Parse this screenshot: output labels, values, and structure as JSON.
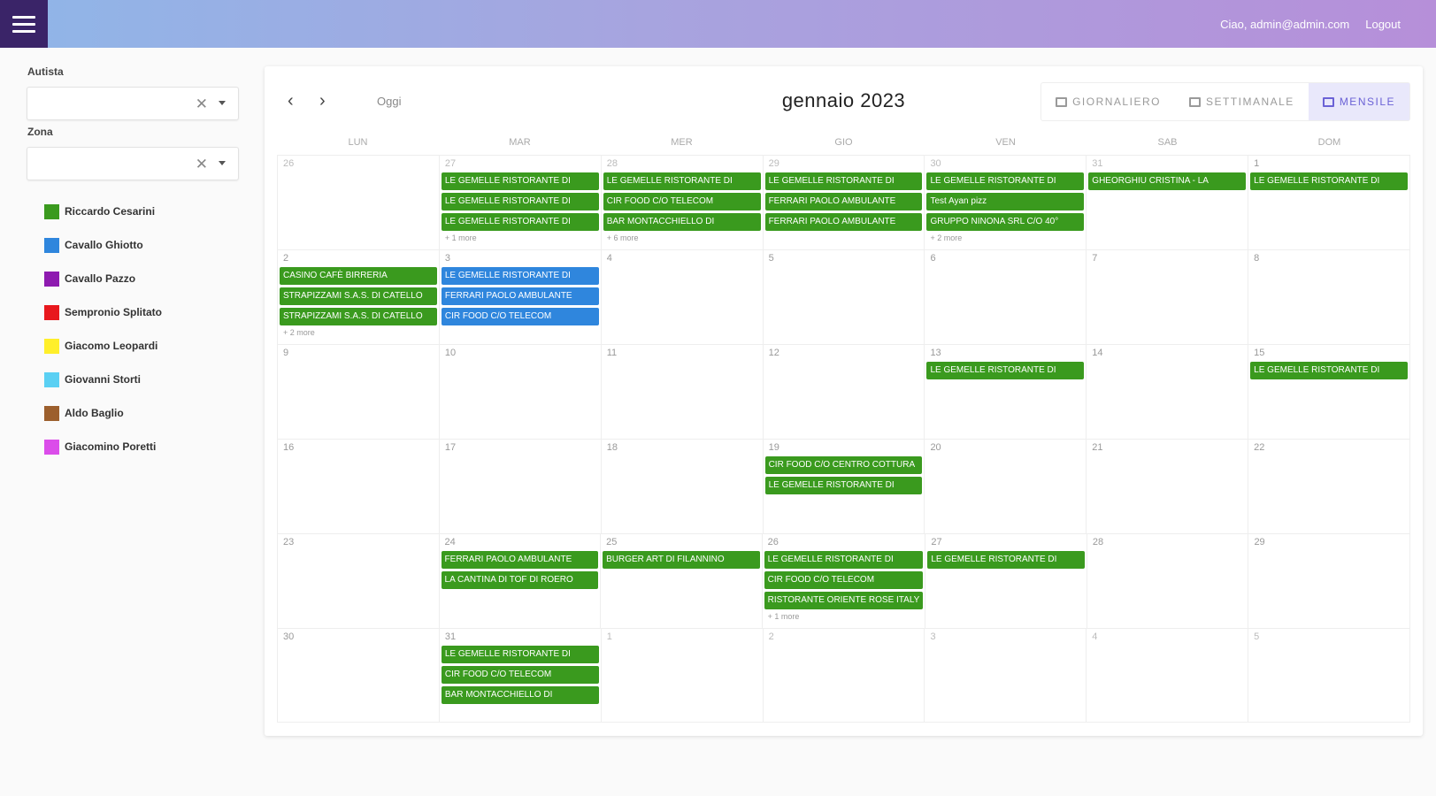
{
  "header": {
    "greeting": "Ciao, admin@admin.com",
    "logout": "Logout"
  },
  "sidebar": {
    "agent_label": "Autista",
    "zone_label": "Zona",
    "legend": [
      {
        "name": "Riccardo Cesarini",
        "color": "#3a9a1e"
      },
      {
        "name": "Cavallo Ghiotto",
        "color": "#2f86dd"
      },
      {
        "name": "Cavallo Pazzo",
        "color": "#8e1ab0"
      },
      {
        "name": "Sempronio Splitato",
        "color": "#e8181d"
      },
      {
        "name": "Giacomo Leopardi",
        "color": "#ffef2a"
      },
      {
        "name": "Giovanni Storti",
        "color": "#5ad0f3"
      },
      {
        "name": "Aldo Baglio",
        "color": "#9c5f2d"
      },
      {
        "name": "Giacomino Poretti",
        "color": "#db4dea"
      }
    ]
  },
  "calendar": {
    "title": "gennaio 2023",
    "today": "Oggi",
    "views": {
      "day": "GIORNALIERO",
      "week": "SETTIMANALE",
      "month": "MENSILE"
    },
    "weekdays": [
      "LUN",
      "MAR",
      "MER",
      "GIO",
      "VEN",
      "SAB",
      "DOM"
    ],
    "weeks": [
      [
        {
          "num": "26",
          "other": true,
          "events": []
        },
        {
          "num": "27",
          "other": true,
          "events": [
            {
              "title": "LE GEMELLE RISTORANTE DI",
              "color": "#3a9a1e"
            },
            {
              "title": "LE GEMELLE RISTORANTE DI",
              "color": "#3a9a1e"
            },
            {
              "title": "LE GEMELLE RISTORANTE DI",
              "color": "#3a9a1e"
            }
          ],
          "more": "+ 1 more"
        },
        {
          "num": "28",
          "other": true,
          "events": [
            {
              "title": "LE GEMELLE RISTORANTE DI",
              "color": "#3a9a1e"
            },
            {
              "title": "CIR FOOD C/O TELECOM",
              "color": "#3a9a1e"
            },
            {
              "title": "BAR MONTACCHIELLO DI",
              "color": "#3a9a1e"
            }
          ],
          "more": "+ 6 more"
        },
        {
          "num": "29",
          "other": true,
          "events": [
            {
              "title": "LE GEMELLE RISTORANTE DI",
              "color": "#3a9a1e"
            },
            {
              "title": "FERRARI PAOLO AMBULANTE",
              "color": "#3a9a1e"
            },
            {
              "title": "FERRARI PAOLO AMBULANTE",
              "color": "#3a9a1e"
            }
          ]
        },
        {
          "num": "30",
          "other": true,
          "events": [
            {
              "title": "LE GEMELLE RISTORANTE DI",
              "color": "#3a9a1e"
            },
            {
              "title": "Test Ayan pizz",
              "color": "#3a9a1e"
            },
            {
              "title": "GRUPPO NINONA SRL C/O 40°",
              "color": "#3a9a1e"
            }
          ],
          "more": "+ 2 more"
        },
        {
          "num": "31",
          "other": true,
          "events": [
            {
              "title": "GHEORGHIU CRISTINA - LA",
              "color": "#3a9a1e"
            }
          ]
        },
        {
          "num": "1",
          "other": false,
          "events": [
            {
              "title": "LE GEMELLE RISTORANTE DI",
              "color": "#3a9a1e"
            }
          ]
        }
      ],
      [
        {
          "num": "2",
          "other": false,
          "events": [
            {
              "title": "CASINO CAFÈ BIRRERIA",
              "color": "#3a9a1e"
            },
            {
              "title": "STRAPIZZAMI S.A.S. DI CATELLO",
              "color": "#3a9a1e"
            },
            {
              "title": "STRAPIZZAMI S.A.S. DI CATELLO",
              "color": "#3a9a1e"
            }
          ],
          "more": "+ 2 more"
        },
        {
          "num": "3",
          "other": false,
          "events": [
            {
              "title": "LE GEMELLE RISTORANTE DI",
              "color": "#2f86dd"
            },
            {
              "title": "FERRARI PAOLO AMBULANTE",
              "color": "#2f86dd"
            },
            {
              "title": "CIR FOOD C/O TELECOM",
              "color": "#2f86dd"
            }
          ]
        },
        {
          "num": "4",
          "other": false,
          "events": []
        },
        {
          "num": "5",
          "other": false,
          "events": []
        },
        {
          "num": "6",
          "other": false,
          "events": []
        },
        {
          "num": "7",
          "other": false,
          "events": []
        },
        {
          "num": "8",
          "other": false,
          "events": []
        }
      ],
      [
        {
          "num": "9",
          "other": false,
          "events": []
        },
        {
          "num": "10",
          "other": false,
          "events": []
        },
        {
          "num": "11",
          "other": false,
          "events": []
        },
        {
          "num": "12",
          "other": false,
          "events": []
        },
        {
          "num": "13",
          "other": false,
          "events": [
            {
              "title": "LE GEMELLE RISTORANTE DI",
              "color": "#3a9a1e"
            }
          ]
        },
        {
          "num": "14",
          "other": false,
          "events": []
        },
        {
          "num": "15",
          "other": false,
          "events": [
            {
              "title": "LE GEMELLE RISTORANTE DI",
              "color": "#3a9a1e"
            }
          ]
        }
      ],
      [
        {
          "num": "16",
          "other": false,
          "events": []
        },
        {
          "num": "17",
          "other": false,
          "events": []
        },
        {
          "num": "18",
          "other": false,
          "events": []
        },
        {
          "num": "19",
          "other": false,
          "events": [
            {
              "title": "CIR FOOD C/O CENTRO COTTURA",
              "color": "#3a9a1e"
            },
            {
              "title": "LE GEMELLE RISTORANTE DI",
              "color": "#3a9a1e"
            }
          ]
        },
        {
          "num": "20",
          "other": false,
          "events": []
        },
        {
          "num": "21",
          "other": false,
          "events": []
        },
        {
          "num": "22",
          "other": false,
          "events": []
        }
      ],
      [
        {
          "num": "23",
          "other": false,
          "events": []
        },
        {
          "num": "24",
          "other": false,
          "events": [
            {
              "title": "FERRARI PAOLO AMBULANTE",
              "color": "#3a9a1e"
            },
            {
              "title": "LA CANTINA DI TOF DI ROERO",
              "color": "#3a9a1e"
            }
          ]
        },
        {
          "num": "25",
          "other": false,
          "events": [
            {
              "title": "BURGER ART DI FILANNINO",
              "color": "#3a9a1e"
            }
          ]
        },
        {
          "num": "26",
          "other": false,
          "events": [
            {
              "title": "LE GEMELLE RISTORANTE DI",
              "color": "#3a9a1e"
            },
            {
              "title": "CIR FOOD C/O TELECOM",
              "color": "#3a9a1e"
            },
            {
              "title": "RISTORANTE ORIENTE ROSE ITALY",
              "color": "#3a9a1e"
            }
          ],
          "more": "+ 1 more"
        },
        {
          "num": "27",
          "other": false,
          "events": [
            {
              "title": "LE GEMELLE RISTORANTE DI",
              "color": "#3a9a1e"
            }
          ]
        },
        {
          "num": "28",
          "other": false,
          "events": []
        },
        {
          "num": "29",
          "other": false,
          "events": []
        }
      ],
      [
        {
          "num": "30",
          "other": false,
          "events": []
        },
        {
          "num": "31",
          "other": false,
          "events": [
            {
              "title": "LE GEMELLE RISTORANTE DI",
              "color": "#3a9a1e"
            },
            {
              "title": "CIR FOOD C/O TELECOM",
              "color": "#3a9a1e"
            },
            {
              "title": "BAR MONTACCHIELLO DI",
              "color": "#3a9a1e"
            }
          ]
        },
        {
          "num": "1",
          "other": true,
          "events": []
        },
        {
          "num": "2",
          "other": true,
          "events": []
        },
        {
          "num": "3",
          "other": true,
          "events": []
        },
        {
          "num": "4",
          "other": true,
          "events": []
        },
        {
          "num": "5",
          "other": true,
          "events": []
        }
      ]
    ]
  }
}
